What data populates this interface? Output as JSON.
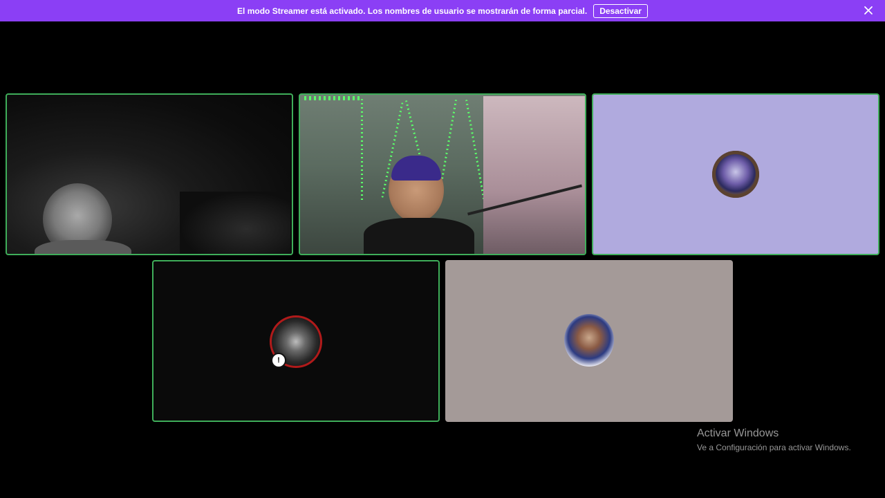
{
  "banner": {
    "message": "El modo Streamer está activado. Los nombres de usuario se mostrarán de forma parcial.",
    "button_label": "Desactivar",
    "background_color": "#8b3ff5",
    "close_icon": "close-icon"
  },
  "participants": [
    {
      "id": 1,
      "kind": "video",
      "speaking": true
    },
    {
      "id": 2,
      "kind": "video",
      "speaking": true
    },
    {
      "id": 3,
      "kind": "avatar",
      "speaking": true,
      "tile_color": "#b0aade"
    },
    {
      "id": 4,
      "kind": "avatar",
      "speaking": true,
      "tile_color": "#0a0a0a",
      "avatar_badge": "!"
    },
    {
      "id": 5,
      "kind": "avatar",
      "speaking": false,
      "tile_color": "#a49a98"
    }
  ],
  "speaking_border_color": "#3fae5a",
  "watermark": {
    "title": "Activar Windows",
    "subtitle": "Ve a Configuración para activar Windows."
  }
}
